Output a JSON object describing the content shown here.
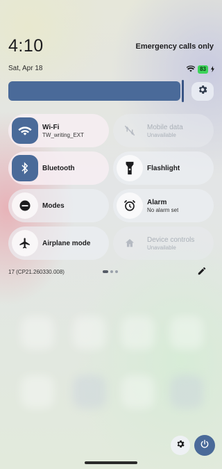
{
  "status": {
    "time": "4:10",
    "emergency": "Emergency calls only",
    "date": "Sat, Apr 18",
    "battery": "83",
    "icons": [
      "wifi-icon",
      "battery-icon",
      "charging-bolt-icon"
    ]
  },
  "brightness": {
    "level": 0.97
  },
  "tiles": [
    {
      "title": "Wi-Fi",
      "subtitle": "TW_writing_EXT",
      "state": "on",
      "icon": "wifi-icon"
    },
    {
      "title": "Mobile data",
      "subtitle": "Unavailable",
      "state": "unavailable",
      "icon": "mobile-data-off-icon"
    },
    {
      "title": "Bluetooth",
      "subtitle": "",
      "state": "on",
      "icon": "bluetooth-icon"
    },
    {
      "title": "Flashlight",
      "subtitle": "",
      "state": "off",
      "icon": "flashlight-icon"
    },
    {
      "title": "Modes",
      "subtitle": "",
      "state": "off",
      "icon": "modes-icon"
    },
    {
      "title": "Alarm",
      "subtitle": "No alarm set",
      "state": "off",
      "icon": "alarm-icon"
    },
    {
      "title": "Airplane mode",
      "subtitle": "",
      "state": "off",
      "icon": "airplane-icon"
    },
    {
      "title": "Device controls",
      "subtitle": "Unavailable",
      "state": "unavailable",
      "icon": "home-icon"
    }
  ],
  "footer": {
    "build": "17 (CP21.260330.008)",
    "pages": 3,
    "active_page": 1
  },
  "colors": {
    "accent": "#4a6a99",
    "battery": "#3cd35a"
  }
}
